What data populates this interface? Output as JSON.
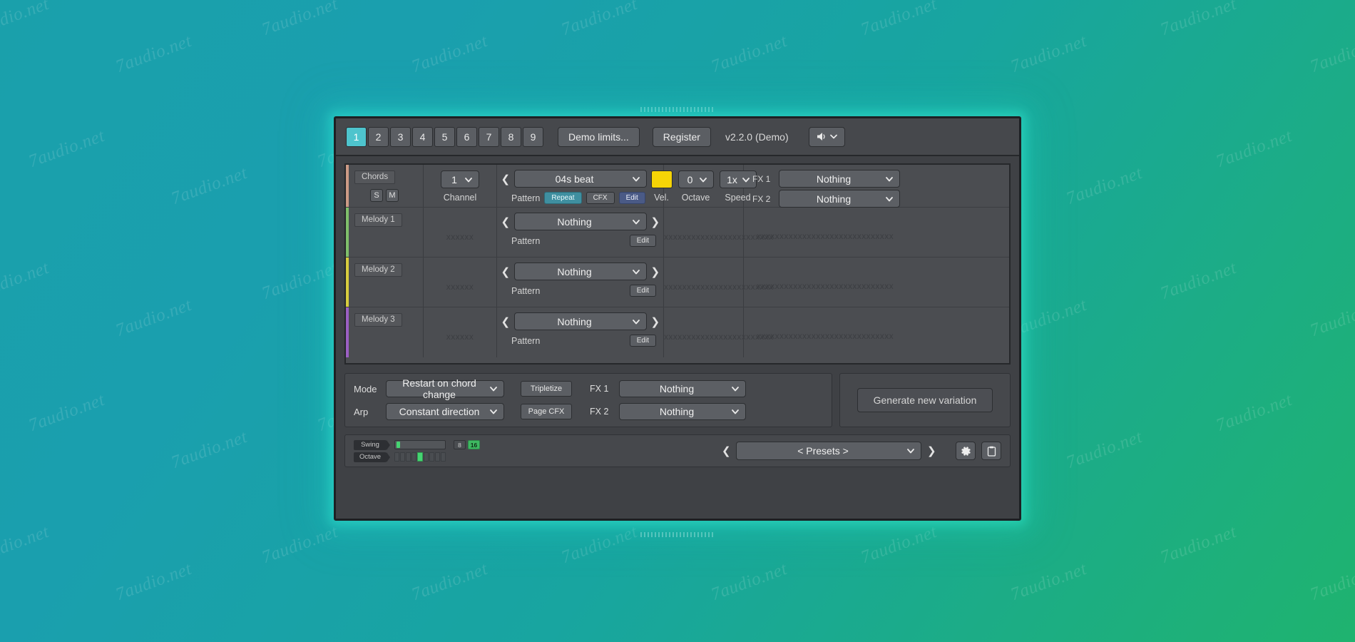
{
  "app": {
    "version_label": "v2.2.0 (Demo)"
  },
  "topbar": {
    "slots": [
      "1",
      "2",
      "3",
      "4",
      "5",
      "6",
      "7",
      "8",
      "9"
    ],
    "active_slot": "1",
    "demo_limits_label": "Demo limits...",
    "register_label": "Register",
    "sound_icon": "speaker-icon",
    "sound_chevron": "chevron-down-icon"
  },
  "tracks": [
    {
      "name": "Chords",
      "color": "#cc9a86",
      "solo_label": "S",
      "mute_label": "M",
      "channel_value": "1",
      "channel_label": "Channel",
      "pattern_value": "04s beat",
      "pattern_label": "Pattern",
      "repeat_label": "Repeat",
      "cfx_label": "CFX",
      "edit_label": "Edit",
      "vel_label": "Vel.",
      "vel_color": "#f6d406",
      "octave_value": "0",
      "octave_label": "Octave",
      "speed_value": "1x",
      "speed_label": "Speed",
      "fx1_label": "FX 1",
      "fx1_value": "Nothing",
      "fx2_label": "FX 2",
      "fx2_value": "Nothing"
    },
    {
      "name": "Melody 1",
      "color": "#7fbf6a",
      "channel_placeholder": "xxxxxx",
      "pattern_value": "Nothing",
      "pattern_label": "Pattern",
      "edit_label": "Edit",
      "mid_placeholder": "xxxxxxxxxxxxxxxxxxxxxxxx",
      "fx_placeholder": "xxxxxxxxxxxxxxxxxxxxxxxxxxxxxx"
    },
    {
      "name": "Melody 2",
      "color": "#d7cc3e",
      "channel_placeholder": "xxxxxx",
      "pattern_value": "Nothing",
      "pattern_label": "Pattern",
      "edit_label": "Edit",
      "mid_placeholder": "xxxxxxxxxxxxxxxxxxxxxxxx",
      "fx_placeholder": "xxxxxxxxxxxxxxxxxxxxxxxxxxxxxx"
    },
    {
      "name": "Melody 3",
      "color": "#9b5fc4",
      "channel_placeholder": "xxxxxx",
      "pattern_value": "Nothing",
      "pattern_label": "Pattern",
      "edit_label": "Edit",
      "mid_placeholder": "xxxxxxxxxxxxxxxxxxxxxxxx",
      "fx_placeholder": "xxxxxxxxxxxxxxxxxxxxxxxxxxxxxx"
    }
  ],
  "midpanel": {
    "mode_label": "Mode",
    "mode_value": "Restart on chord change",
    "arp_label": "Arp",
    "arp_value": "Constant direction",
    "tripletize_label": "Tripletize",
    "page_cfx_label": "Page CFX",
    "fx1_label": "FX 1",
    "fx1_value": "Nothing",
    "fx2_label": "FX 2",
    "fx2_value": "Nothing",
    "generate_label": "Generate new variation"
  },
  "bottombar": {
    "swing_label": "Swing",
    "swing_position_pct": 2,
    "swing_div_8": "8",
    "swing_div_16": "16",
    "swing_div_active": "16",
    "octave_label": "Octave",
    "octave_segments": 9,
    "octave_active_index": 4,
    "preset_value": "< Presets >",
    "prev_arrow": "chevron-left-icon",
    "next_arrow": "chevron-right-icon",
    "settings_icon": "gear-icon",
    "clipboard_icon": "clipboard-icon"
  },
  "watermark": {
    "text": "7audio.net"
  }
}
